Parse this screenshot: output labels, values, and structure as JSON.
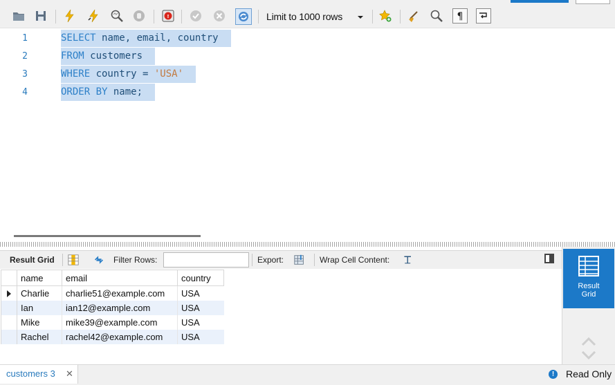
{
  "toolbar": {
    "limit_label": "Limit to 1000 rows"
  },
  "editor": {
    "lines": [
      {
        "num": "1",
        "kw1": "SELECT ",
        "rest": "name, email, country"
      },
      {
        "num": "2",
        "kw1": "FROM ",
        "rest": "customers"
      },
      {
        "num": "3",
        "kw1": "WHERE ",
        "rest": "country = ",
        "str": "'USA'"
      },
      {
        "num": "4",
        "kw1": "ORDER BY ",
        "rest": "name;"
      }
    ]
  },
  "result_toolbar": {
    "result_grid_label": "Result Grid",
    "filter_label": "Filter Rows:",
    "filter_value": "",
    "export_label": "Export:",
    "wrap_label": "Wrap Cell Content:"
  },
  "grid": {
    "columns": [
      "name",
      "email",
      "country"
    ],
    "rows": [
      [
        "Charlie",
        "charlie51@example.com",
        "USA"
      ],
      [
        "Ian",
        "ian12@example.com",
        "USA"
      ],
      [
        "Mike",
        "mike39@example.com",
        "USA"
      ],
      [
        "Rachel",
        "rachel42@example.com",
        "USA"
      ]
    ]
  },
  "side_panel": {
    "result_grid_button_line1": "Result",
    "result_grid_button_line2": "Grid"
  },
  "status": {
    "tab_label": "customers 3",
    "read_only": "Read Only"
  },
  "colors": {
    "accent": "#1c79c8",
    "keyword": "#2d80c8",
    "string": "#c27a40",
    "selection": "#c9ddf3"
  }
}
